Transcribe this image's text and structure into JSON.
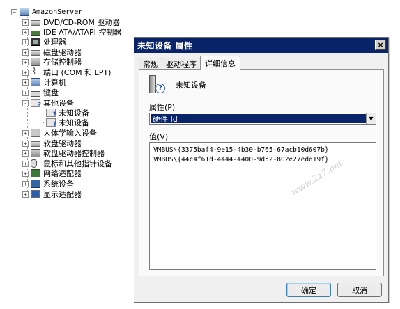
{
  "tree": {
    "root": "AmazonServer",
    "items": [
      {
        "label": "DVD/CD-ROM 驱动器",
        "icon": "cd-drive-icon",
        "expander": "+"
      },
      {
        "label": "IDE ATA/ATAPI 控制器",
        "icon": "ide-controller-icon",
        "expander": "+"
      },
      {
        "label": "处理器",
        "icon": "processor-icon",
        "expander": "+"
      },
      {
        "label": "磁盘驱动器",
        "icon": "disk-drive-icon",
        "expander": "+"
      },
      {
        "label": "存储控制器",
        "icon": "storage-controller-icon",
        "expander": "+"
      },
      {
        "label": "端口 (COM 和 LPT)",
        "icon": "port-icon",
        "expander": "+"
      },
      {
        "label": "计算机",
        "icon": "computer-icon",
        "expander": "+"
      },
      {
        "label": "键盘",
        "icon": "keyboard-icon",
        "expander": "+"
      },
      {
        "label": "其他设备",
        "icon": "unknown-device-icon",
        "expander": "-"
      },
      {
        "label": "人体学输入设备",
        "icon": "hid-icon",
        "expander": "+"
      },
      {
        "label": "软盘驱动器",
        "icon": "floppy-drive-icon",
        "expander": "+"
      },
      {
        "label": "软盘驱动器控制器",
        "icon": "floppy-controller-icon",
        "expander": "+"
      },
      {
        "label": "鼠标和其他指针设备",
        "icon": "mouse-icon",
        "expander": "+"
      },
      {
        "label": "网络适配器",
        "icon": "network-adapter-icon",
        "expander": "+"
      },
      {
        "label": "系统设备",
        "icon": "system-device-icon",
        "expander": "+"
      },
      {
        "label": "显示适配器",
        "icon": "display-adapter-icon",
        "expander": "+"
      }
    ],
    "other_children": [
      "未知设备",
      "未知设备"
    ]
  },
  "dialog": {
    "title": "未知设备 属性",
    "close": "×",
    "tabs": [
      {
        "label": "常规",
        "active": false
      },
      {
        "label": "驱动程序",
        "active": false
      },
      {
        "label": "详细信息",
        "active": true
      }
    ],
    "device_name": "未知设备",
    "property_label": "属性(P)",
    "property_value": "硬件 Id",
    "value_label": "值(V)",
    "values": [
      "VMBUS\\{3375baf4-9e15-4b30-b765-67acb10d607b}",
      "VMBUS\\{44c4f61d-4444-4400-9d52-802e27ede19f}"
    ],
    "ok": "确定",
    "cancel": "取消"
  },
  "watermark": "www.2z7.net",
  "colors": {
    "titlebar": "#0a246a",
    "selection": "#0a246a",
    "dialog_bg": "#f0f0f0"
  }
}
